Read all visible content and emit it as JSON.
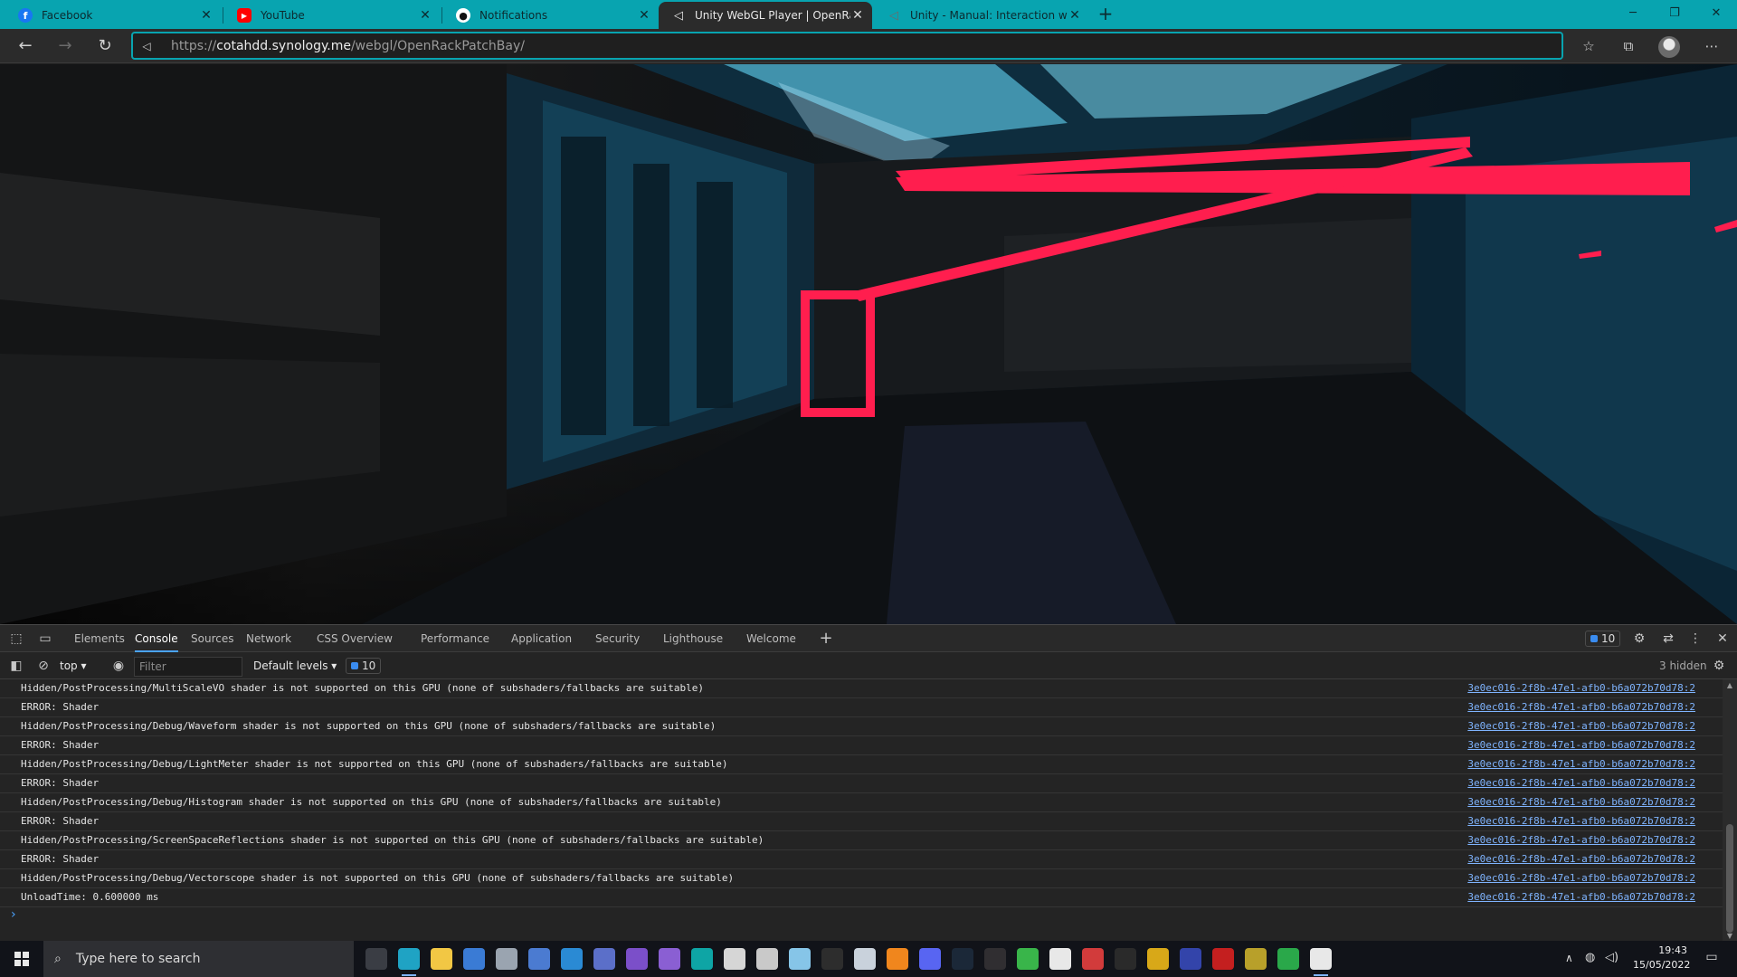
{
  "browser": {
    "tabs": [
      {
        "title": "Facebook",
        "icon": "facebook-icon",
        "color": "#1877f2"
      },
      {
        "title": "YouTube",
        "icon": "youtube-icon",
        "color": "#ff0000"
      },
      {
        "title": "Notifications",
        "icon": "github-icon",
        "color": "#111111"
      },
      {
        "title": "Unity WebGL Player | OpenRackF",
        "icon": "unity-icon",
        "color": "#e8e8e8",
        "active": true
      },
      {
        "title": "Unity - Manual: Interaction with",
        "icon": "unity-icon",
        "color": "#555555"
      }
    ],
    "new_tab_glyph": "+",
    "url_prefix": "https://",
    "url_host": "cotahdd.synology.me",
    "url_path": "/webgl/OpenRackPatchBay/",
    "accent": "#08a4b0"
  },
  "devtools": {
    "tabs": [
      "Elements",
      "Console",
      "Sources",
      "Network",
      "CSS Overview",
      "Performance",
      "Application",
      "Security",
      "Lighthouse",
      "Welcome"
    ],
    "active_tab": "Console",
    "issue_count": "10",
    "context": "top",
    "filter_placeholder": "Filter",
    "levels": "Default levels",
    "message_count": "10",
    "hidden_label": "3 hidden",
    "source_link": "3e0ec016-2f8b-47e1-afb0-b6a072b70d78:2",
    "rows": [
      "Hidden/PostProcessing/MultiScaleVO shader is not supported on this GPU (none of subshaders/fallbacks are suitable)",
      "ERROR: Shader",
      "Hidden/PostProcessing/Debug/Waveform shader is not supported on this GPU (none of subshaders/fallbacks are suitable)",
      "ERROR: Shader",
      "Hidden/PostProcessing/Debug/LightMeter shader is not supported on this GPU (none of subshaders/fallbacks are suitable)",
      "ERROR: Shader",
      "Hidden/PostProcessing/Debug/Histogram shader is not supported on this GPU (none of subshaders/fallbacks are suitable)",
      "ERROR: Shader",
      "Hidden/PostProcessing/ScreenSpaceReflections shader is not supported on this GPU (none of subshaders/fallbacks are suitable)",
      "ERROR: Shader",
      "Hidden/PostProcessing/Debug/Vectorscope shader is not supported on this GPU (none of subshaders/fallbacks are suitable)",
      "UnloadTime: 0.600000 ms"
    ],
    "prompt_glyph": "›"
  },
  "taskbar": {
    "search_placeholder": "Type here to search",
    "time": "19:43",
    "date": "15/05/2022",
    "apps": [
      {
        "name": "task-view-icon",
        "color": "#3a3d44"
      },
      {
        "name": "edge-icon",
        "color": "#1fa3c4"
      },
      {
        "name": "file-explorer-icon",
        "color": "#f2c744"
      },
      {
        "name": "store-icon",
        "color": "#3a7bd5"
      },
      {
        "name": "app-icon-5",
        "color": "#9aa4b0"
      },
      {
        "name": "app-icon-6",
        "color": "#4b7bd1"
      },
      {
        "name": "visual-studio-code-icon",
        "color": "#2a8ad4"
      },
      {
        "name": "app-icon-8",
        "color": "#5b6fc9"
      },
      {
        "name": "visual-studio-icon",
        "color": "#7b4fc9"
      },
      {
        "name": "github-desktop-icon",
        "color": "#8a5fd3"
      },
      {
        "name": "arduino-icon",
        "color": "#0ea5a5"
      },
      {
        "name": "app-icon-12",
        "color": "#d6d6d6"
      },
      {
        "name": "app-icon-13",
        "color": "#c9c9c9"
      },
      {
        "name": "app-icon-14",
        "color": "#86c5e8"
      },
      {
        "name": "terminal-icon",
        "color": "#2d2d2d"
      },
      {
        "name": "app-icon-16",
        "color": "#c9d2dc"
      },
      {
        "name": "blender-icon",
        "color": "#f0861d"
      },
      {
        "name": "discord-icon",
        "color": "#5865f2"
      },
      {
        "name": "steam-icon",
        "color": "#1b2838"
      },
      {
        "name": "obs-icon",
        "color": "#302e31"
      },
      {
        "name": "xbox-icon",
        "color": "#39b54a"
      },
      {
        "name": "unity-hub-icon",
        "color": "#e8e8e8"
      },
      {
        "name": "app-icon-23",
        "color": "#d23b3b"
      },
      {
        "name": "app-icon-24",
        "color": "#2a2a2a"
      },
      {
        "name": "app-icon-25",
        "color": "#d8a818"
      },
      {
        "name": "app-icon-26",
        "color": "#3344aa"
      },
      {
        "name": "app-icon-27",
        "color": "#c41f1f"
      },
      {
        "name": "app-icon-28",
        "color": "#b8a02a"
      },
      {
        "name": "app-icon-29",
        "color": "#2aa84a"
      },
      {
        "name": "unity-icon",
        "color": "#e8e8e8"
      }
    ]
  }
}
